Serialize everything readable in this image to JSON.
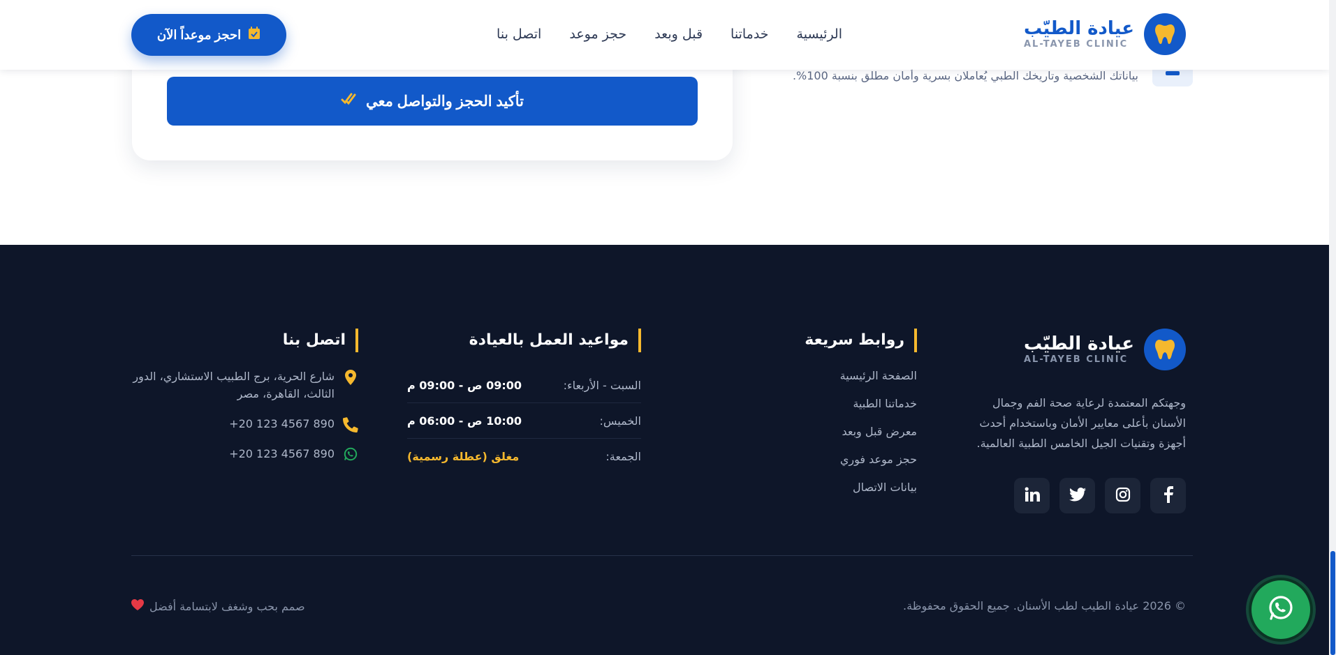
{
  "brand": {
    "name": "عيادة الطيّب",
    "sub": "AL-TAYEB CLINIC"
  },
  "nav": {
    "items": [
      {
        "label": "الرئيسية"
      },
      {
        "label": "خدماتنا"
      },
      {
        "label": "قبل وبعد"
      },
      {
        "label": "حجز موعد"
      },
      {
        "label": "اتصل بنا"
      }
    ],
    "cta_label": "احجز موعداً الآن"
  },
  "form": {
    "confirm_label": "تأكيد الحجز والتواصل معي",
    "privacy_text": "بياناتك الشخصية وتاريخك الطبي يُعاملان بسرية وأمان مطلق بنسبة 100%."
  },
  "footer": {
    "brand_name": "عيادة الطيّب",
    "brand_sub": "AL-TAYEB CLINIC",
    "description": "وجهتكم المعتمدة لرعاية صحة الفم وجمال الأسنان بأعلى معايير الأمان وباستخدام أحدث أجهزة وتقنيات الجيل الخامس الطبية العالمية.",
    "socials": [
      "facebook-icon",
      "instagram-icon",
      "twitter-icon",
      "linkedin-icon"
    ],
    "quick_links": {
      "title": "روابط سريعة",
      "items": [
        "الصفحة الرئيسية",
        "خدماتنا الطبية",
        "معرض قبل وبعد",
        "حجز موعد فوري",
        "بيانات الاتصال"
      ]
    },
    "hours": {
      "title": "مواعيد العمل بالعيادة",
      "rows": [
        {
          "day": "السبت - الأربعاء:",
          "time": "09:00 ص - 09:00 م"
        },
        {
          "day": "الخميس:",
          "time": "10:00 ص - 06:00 م"
        },
        {
          "day": "الجمعة:",
          "time": "مغلق (عطلة رسمية)"
        }
      ]
    },
    "contact": {
      "title": "اتصل بنا",
      "address": "شارع الحرية، برج الطبيب الاستشاري، الدور الثالث، القاهرة، مصر",
      "phone": "+20 123 4567 890",
      "whatsapp": "+20 123 4567 890"
    },
    "copyright": "© 2026 عيادة الطيب لطب الأسنان. جميع الحقوق محفوظة.",
    "made_with": "صمم بحب وشغف لابتسامة أفضل"
  },
  "colors": {
    "primary": "#1259c9",
    "accent": "#f5b82e",
    "footer_bg": "#0e1629",
    "whatsapp": "#22a95c",
    "heart": "#e53945"
  }
}
